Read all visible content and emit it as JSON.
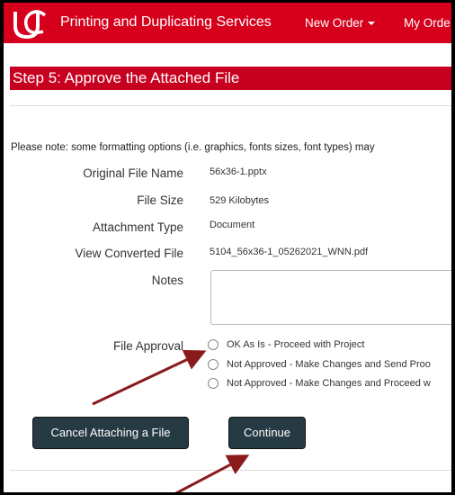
{
  "header": {
    "brand": "Printing and Duplicating Services",
    "nav": [
      {
        "label": "New Order",
        "has_caret": true
      },
      {
        "label": "My Orde",
        "has_caret": false
      }
    ]
  },
  "step": {
    "title": "Step 5: Approve the Attached File",
    "note": "Please note: some formatting options (i.e. graphics, fonts sizes, font types) may"
  },
  "fields": {
    "original_file_name": {
      "label": "Original File Name",
      "value": "56x36-1.pptx"
    },
    "file_size": {
      "label": "File Size",
      "value": "529 Kilobytes"
    },
    "attachment_type": {
      "label": "Attachment Type",
      "value": "Document"
    },
    "view_converted_file": {
      "label": "View Converted File",
      "value": "5104_56x36-1_05262021_WNN.pdf"
    },
    "notes": {
      "label": "Notes",
      "value": ""
    }
  },
  "approval": {
    "label": "File Approval",
    "options": [
      "OK As Is - Proceed with Project",
      "Not Approved - Make Changes and Send Proo",
      "Not Approved - Make Changes and Proceed w"
    ]
  },
  "buttons": {
    "cancel": "Cancel Attaching a File",
    "continue": "Continue"
  },
  "colors": {
    "brand_red": "#d6001c",
    "header_red": "#c8001f",
    "button_dark": "#263a44",
    "arrow": "#8b1a1a"
  }
}
